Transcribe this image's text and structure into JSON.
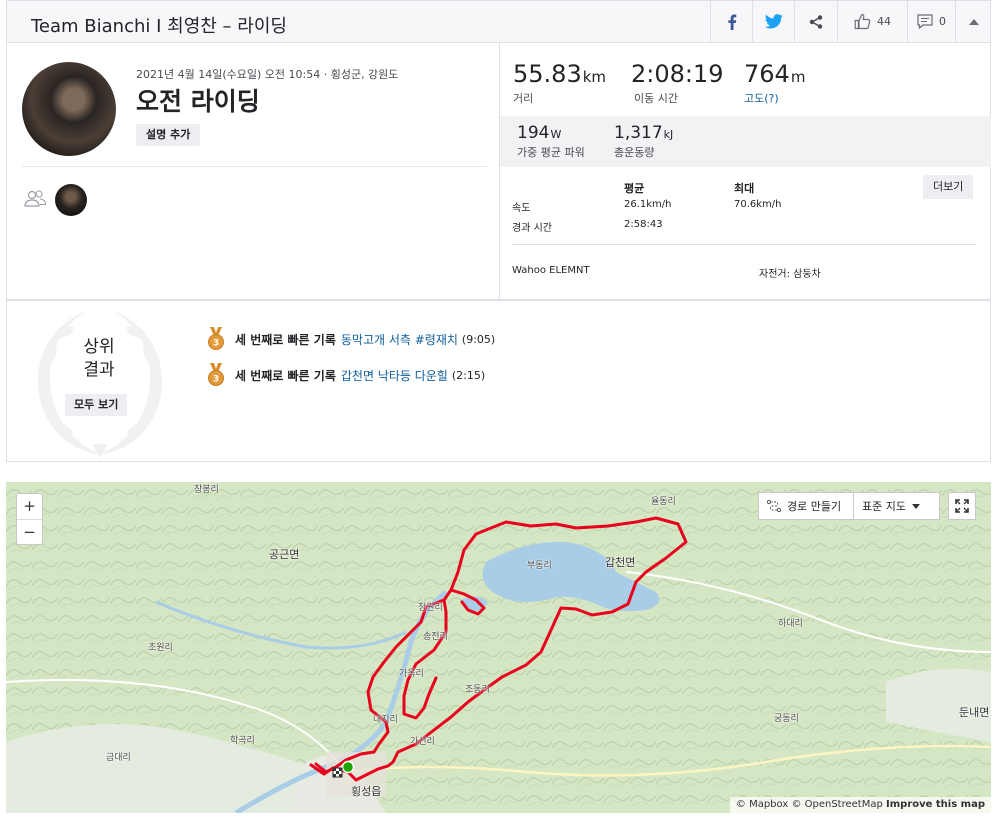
{
  "header": {
    "title": "Team Bianchi I 최영찬 – 라이딩",
    "kudos_count": "44",
    "comment_count": "0"
  },
  "activity": {
    "datetime_location": "2021년 4월 14일(수요일) 오전 10:54 · 횡성군, 강원도",
    "title": "오전 라이딩",
    "add_description_label": "설명 추가"
  },
  "stats": {
    "distance": {
      "value": "55.83",
      "unit": "km",
      "label": "거리"
    },
    "moving_time": {
      "value": "2:08:19",
      "label": "이동 시간"
    },
    "elevation": {
      "value": "764",
      "unit": "m",
      "label": "고도(?)"
    },
    "weighted_power": {
      "value": "194",
      "unit": "W",
      "label": "가중 평균 파워"
    },
    "total_work": {
      "value": "1,317",
      "unit": "kJ",
      "label": "총운동량"
    }
  },
  "details_table": {
    "col_avg": "평균",
    "col_max": "최대",
    "more_label": "더보기",
    "rows": [
      {
        "label": "속도",
        "avg": "26.1km/h",
        "max": "70.6km/h"
      },
      {
        "label": "경과 시간",
        "avg": "2:58:43",
        "max": ""
      }
    ]
  },
  "device": "Wahoo ELEMNT",
  "bike": "자전거: 삼둥차",
  "results": {
    "title_line1": "상위",
    "title_line2": "결과",
    "view_all_label": "모두 보기",
    "achievements": [
      {
        "rank": "3",
        "lead": "세 번째로 빠른 기록",
        "segment": "동막고개 서측 #령재치",
        "time": "(9:05)"
      },
      {
        "rank": "3",
        "lead": "세 번째로 빠른 기록",
        "segment": "갑천면 낙타등 다운힐",
        "time": "(2:15)"
      }
    ]
  },
  "map": {
    "zoom_in": "+",
    "zoom_out": "−",
    "route_builder_label": "경로 만들기",
    "map_style_label": "표준 지도",
    "attribution": {
      "mapbox": "© Mapbox",
      "osm": "© OpenStreetMap",
      "improve": "Improve this map"
    },
    "labels": [
      {
        "text": "창봉리"
      },
      {
        "text": "공근면"
      },
      {
        "text": "초원리"
      },
      {
        "text": "학곡리"
      },
      {
        "text": "금대리"
      },
      {
        "text": "횡성읍"
      },
      {
        "text": "부동리"
      },
      {
        "text": "갑천면"
      },
      {
        "text": "율동리"
      },
      {
        "text": "하대리"
      },
      {
        "text": "궁동리"
      },
      {
        "text": "둔내면"
      },
      {
        "text": "송전리"
      },
      {
        "text": "가옥리"
      },
      {
        "text": "내지리"
      },
      {
        "text": "가선리"
      },
      {
        "text": "조동리"
      },
      {
        "text": "청원리"
      }
    ]
  },
  "colors": {
    "brand_orange": "#fc4c02",
    "link_blue": "#0d5d9c",
    "route_red": "#e8001c",
    "start_green": "#19a400",
    "medal_bronze": "#d98c2b"
  }
}
